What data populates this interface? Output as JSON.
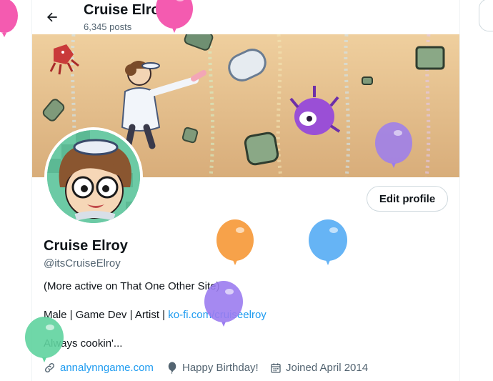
{
  "header": {
    "title": "Cruise Elroy",
    "post_count": "6,345 posts"
  },
  "profile": {
    "name": "Cruise Elroy",
    "handle": "@itsCruiseElroy",
    "edit_label": "Edit profile",
    "bio_line1": "(More active on That One Other Site)",
    "bio_line2_prefix": "Male | Game Dev | Artist | ",
    "bio_line2_link": "ko-fi.com/cruiseelroy",
    "bio_line3": "Always cookin'...",
    "website": "annalynngame.com",
    "birthday": "Happy Birthday!",
    "joined": "Joined April 2014"
  },
  "icons": {
    "back": "arrow-left-icon",
    "link": "link-icon",
    "birthday": "balloon-icon",
    "joined": "calendar-icon"
  },
  "colors": {
    "accent": "#1d9bf0",
    "balloon_pink": "#f45bb0",
    "balloon_orange": "#f7a24a",
    "balloon_blue": "#66b4f5",
    "balloon_purple": "#9b7cf0",
    "balloon_green": "#5fd39e"
  }
}
